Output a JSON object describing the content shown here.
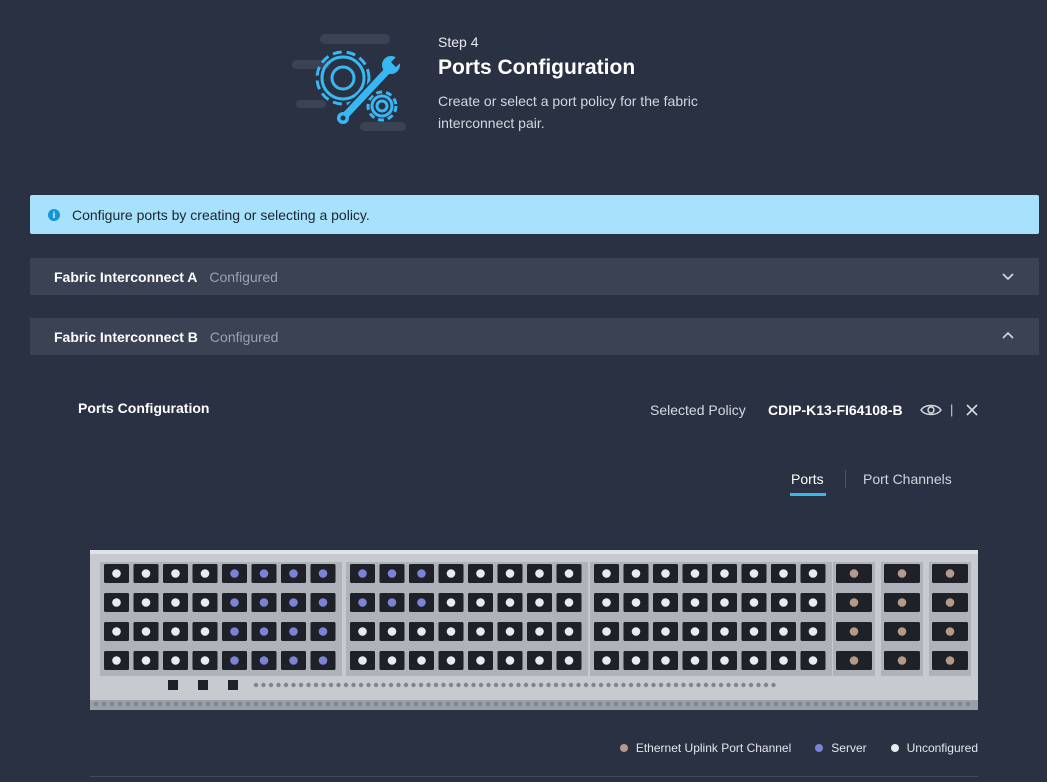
{
  "header": {
    "step": "Step 4",
    "title": "Ports Configuration",
    "description": "Create or select a port policy for the fabric interconnect pair.",
    "icon": "gear-wrench-icon"
  },
  "banner": {
    "text": "Configure ports by creating or selecting a policy.",
    "icon": "info-icon"
  },
  "fabric_a": {
    "title": "Fabric Interconnect A",
    "status": "Configured",
    "expanded": false
  },
  "fabric_b": {
    "title": "Fabric Interconnect B",
    "status": "Configured",
    "expanded": true
  },
  "ports_panel": {
    "title": "Ports Configuration",
    "selected_policy_label": "Selected Policy",
    "selected_policy_value": "CDIP-K13-FI64108-B",
    "tabs": [
      {
        "label": "Ports",
        "active": true
      },
      {
        "label": "Port Channels",
        "active": false
      }
    ]
  },
  "legend": [
    {
      "label": "Ethernet Uplink Port Channel",
      "color": "#b39a8b"
    },
    {
      "label": "Server",
      "color": "#7a83d6"
    },
    {
      "label": "Unconfigured",
      "color": "#e8ebf0"
    }
  ],
  "colors": {
    "accent": "#38b8f2",
    "banner_bg": "#a7e1fb",
    "page_bg": "#2a3142",
    "accordion_bg": "#3a4253"
  }
}
